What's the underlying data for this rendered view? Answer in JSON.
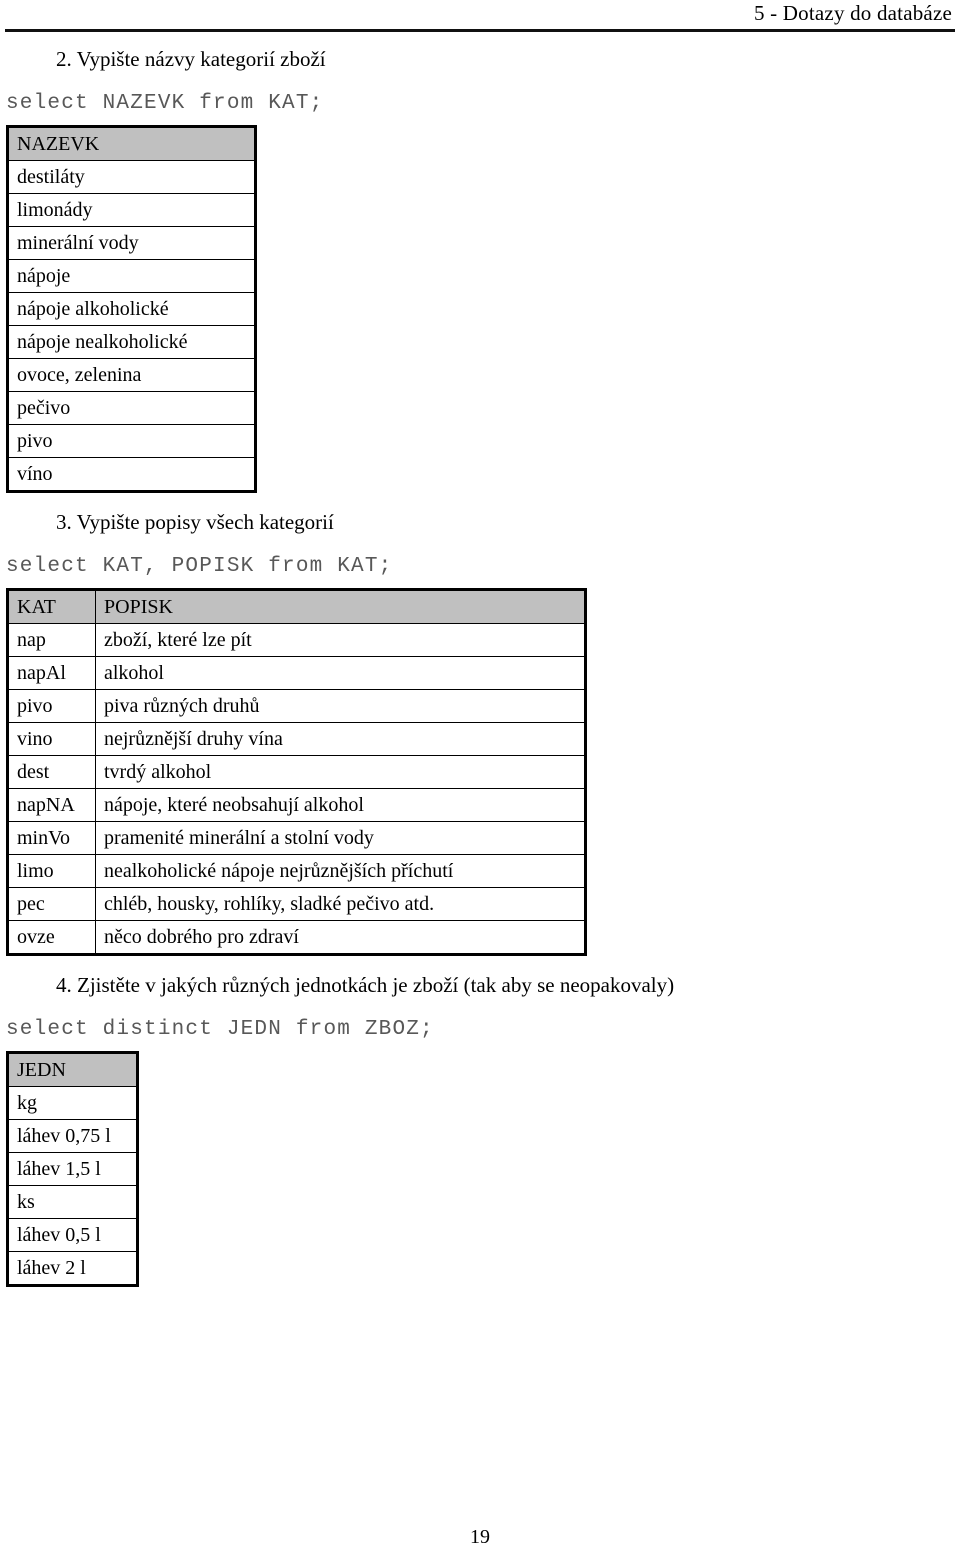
{
  "page": {
    "running_header": "5 - Dotazy do databáze",
    "page_number": "19"
  },
  "sections": [
    {
      "heading": "2. Vypište názvy kategorií zboží",
      "sql": "select NAZEVK from KAT;",
      "table": {
        "name": "nazevk-result",
        "columns": [
          "NAZEVK"
        ],
        "rows": [
          [
            "destiláty"
          ],
          [
            "limonády"
          ],
          [
            "minerální vody"
          ],
          [
            "nápoje"
          ],
          [
            "nápoje alkoholické"
          ],
          [
            "nápoje nealkoholické"
          ],
          [
            "ovoce, zelenina"
          ],
          [
            "pečivo"
          ],
          [
            "pivo"
          ],
          [
            "víno"
          ]
        ]
      }
    },
    {
      "heading": "3. Vypište popisy všech kategorií",
      "sql": "select KAT, POPISK from KAT;",
      "table": {
        "name": "kat-popisk-result",
        "columns": [
          "KAT",
          "POPISK"
        ],
        "rows": [
          [
            "nap",
            "zboží, které lze pít"
          ],
          [
            "napAl",
            "alkohol"
          ],
          [
            "pivo",
            "piva různých druhů"
          ],
          [
            "vino",
            "nejrůznější druhy vína"
          ],
          [
            "dest",
            "tvrdý alkohol"
          ],
          [
            "napNA",
            "nápoje, které neobsahují alkohol"
          ],
          [
            "minVo",
            "pramenité minerální a stolní vody"
          ],
          [
            "limo",
            "nealkoholické nápoje nejrůznějších příchutí"
          ],
          [
            "pec",
            "chléb, housky, rohlíky, sladké pečivo atd."
          ],
          [
            "ovze",
            "něco dobrého pro zdraví"
          ]
        ]
      }
    },
    {
      "heading": "4. Zjistěte v jakých různých jednotkách je zboží (tak aby se neopakovaly)",
      "sql": "select distinct JEDN from ZBOZ;",
      "table": {
        "name": "jedn-result",
        "columns": [
          "JEDN"
        ],
        "rows": [
          [
            "kg"
          ],
          [
            "láhev 0,75 l"
          ],
          [
            "láhev 1,5 l"
          ],
          [
            "ks"
          ],
          [
            "láhev 0,5 l"
          ],
          [
            "láhev 2 l"
          ]
        ]
      }
    }
  ],
  "colors": {
    "table_header_bg": "#c0c0c0",
    "sql_text": "#585858",
    "rule": "#111111"
  }
}
